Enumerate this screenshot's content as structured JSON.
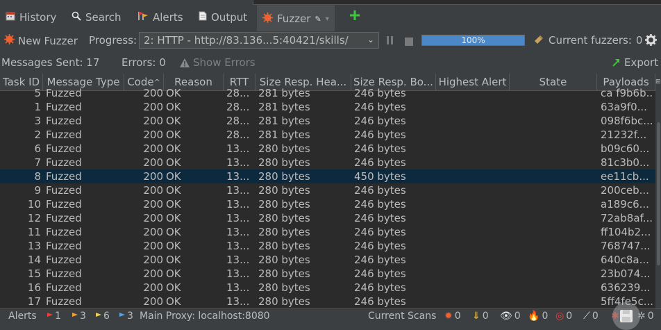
{
  "tabs": [
    {
      "label": "History",
      "icon": "calendar-icon"
    },
    {
      "label": "Search",
      "icon": "search-icon"
    },
    {
      "label": "Alerts",
      "icon": "flags-icon"
    },
    {
      "label": "Output",
      "icon": "document-icon"
    },
    {
      "label": "Fuzzer",
      "icon": "fuzzer-icon",
      "active": true
    }
  ],
  "toolbar": {
    "new_fuzzer_label": "New Fuzzer",
    "progress_label": "Progress:",
    "progress_select": "2: HTTP - http://83.136...5:40421/skills/",
    "progress_percent": 100,
    "progress_text": "100%",
    "current_fuzzers_label": "Current fuzzers:",
    "current_fuzzers_value": "0"
  },
  "stats": {
    "messages_sent": "Messages Sent: 17",
    "errors": "Errors: 0",
    "show_errors": "Show Errors",
    "export": "Export"
  },
  "table": {
    "columns": [
      "Task ID",
      "Message Type",
      "Code",
      "Reason",
      "RTT",
      "Size Resp. Hea...",
      "Size Resp. Bo...",
      "Highest Alert",
      "State",
      "Payloads"
    ],
    "rows": [
      [
        "5",
        "Fuzzed",
        "200",
        "OK",
        "28...",
        "281 bytes",
        "246 bytes",
        "",
        "",
        "ca f9b6b..."
      ],
      [
        "1",
        "Fuzzed",
        "200",
        "OK",
        "28...",
        "281 bytes",
        "246 bytes",
        "",
        "",
        "63a9f0..."
      ],
      [
        "3",
        "Fuzzed",
        "200",
        "OK",
        "28...",
        "281 bytes",
        "246 bytes",
        "",
        "",
        "098f6bc..."
      ],
      [
        "2",
        "Fuzzed",
        "200",
        "OK",
        "28...",
        "281 bytes",
        "246 bytes",
        "",
        "",
        "21232f..."
      ],
      [
        "6",
        "Fuzzed",
        "200",
        "OK",
        "13...",
        "280 bytes",
        "246 bytes",
        "",
        "",
        "b09c60..."
      ],
      [
        "7",
        "Fuzzed",
        "200",
        "OK",
        "13...",
        "280 bytes",
        "246 bytes",
        "",
        "",
        "81c3b0..."
      ],
      [
        "8",
        "Fuzzed",
        "200",
        "OK",
        "13...",
        "280 bytes",
        "450 bytes",
        "",
        "",
        "ee11cb..."
      ],
      [
        "9",
        "Fuzzed",
        "200",
        "OK",
        "13...",
        "280 bytes",
        "246 bytes",
        "",
        "",
        "200ceb..."
      ],
      [
        "10",
        "Fuzzed",
        "200",
        "OK",
        "13...",
        "280 bytes",
        "246 bytes",
        "",
        "",
        "a189c6..."
      ],
      [
        "12",
        "Fuzzed",
        "200",
        "OK",
        "13...",
        "280 bytes",
        "246 bytes",
        "",
        "",
        "72ab8af..."
      ],
      [
        "11",
        "Fuzzed",
        "200",
        "OK",
        "13...",
        "280 bytes",
        "246 bytes",
        "",
        "",
        "ff104b2..."
      ],
      [
        "13",
        "Fuzzed",
        "200",
        "OK",
        "13...",
        "280 bytes",
        "246 bytes",
        "",
        "",
        "768747..."
      ],
      [
        "14",
        "Fuzzed",
        "200",
        "OK",
        "13...",
        "280 bytes",
        "246 bytes",
        "",
        "",
        "640c8a..."
      ],
      [
        "15",
        "Fuzzed",
        "200",
        "OK",
        "13...",
        "280 bytes",
        "246 bytes",
        "",
        "",
        "23b074..."
      ],
      [
        "16",
        "Fuzzed",
        "200",
        "OK",
        "13...",
        "280 bytes",
        "246 bytes",
        "",
        "",
        "636239..."
      ],
      [
        "17",
        "Fuzzed",
        "200",
        "OK",
        "13...",
        "280 bytes",
        "246 bytes",
        "",
        "",
        "5ff4fe5c..."
      ]
    ],
    "selected_row": 6
  },
  "footer": {
    "alerts_label": "Alerts",
    "alert_counts": [
      "1",
      "3",
      "6",
      "3"
    ],
    "alert_colors": [
      "#e8413b",
      "#f0a030",
      "#f0d050",
      "#5aa0e0"
    ],
    "main_proxy": "Main Proxy: localhost:8080",
    "current_scans": "Current Scans",
    "scan_counts": [
      "0",
      "0",
      "0",
      "0",
      "0",
      "0",
      "0",
      "0"
    ]
  },
  "colors": {
    "background": "#3c3f41",
    "table_bg": "#2b2b2b",
    "selection": "#0d293e",
    "progress_fill": "#4a88c7",
    "add_green": "#3ec63e"
  }
}
